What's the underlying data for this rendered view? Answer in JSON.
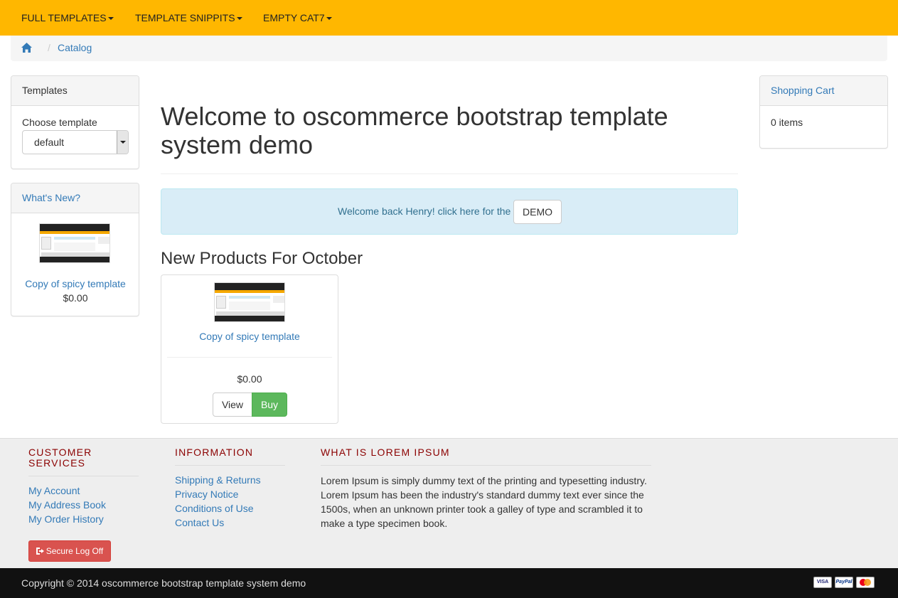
{
  "navbar": {
    "items": [
      {
        "label": "FULL TEMPLATES"
      },
      {
        "label": "TEMPLATE SNIPPITS"
      },
      {
        "label": "EMPTY CAT7"
      }
    ]
  },
  "breadcrumb": {
    "current": "Catalog"
  },
  "left": {
    "templates_panel": {
      "title": "Templates",
      "choose_label": "Choose template",
      "selected": "default"
    },
    "whats_new": {
      "title": "What's New?",
      "product_name": "Copy of spicy template",
      "price": "$0.00"
    }
  },
  "right": {
    "cart": {
      "title": "Shopping Cart",
      "items_text": "0 items"
    }
  },
  "main": {
    "title_line1": "Welcome to oscommerce bootstrap template",
    "title_line2": "system demo",
    "alert_text": "Welcome back Henry! click here for the",
    "demo_button": "DEMO",
    "section_title": "New Products For October",
    "product": {
      "name": "Copy of spicy template",
      "price": "$0.00",
      "view_label": "View",
      "buy_label": "Buy"
    }
  },
  "footer": {
    "col1": {
      "heading_line1": "CUSTOMER",
      "heading_line2": "SERVICES",
      "links": [
        "My Account",
        "My Address Book",
        "My Order History"
      ],
      "logoff_label": "Secure Log Off"
    },
    "col2": {
      "heading": "INFORMATION",
      "links": [
        "Shipping & Returns",
        "Privacy Notice",
        "Conditions of Use",
        "Contact Us"
      ]
    },
    "col3": {
      "heading": "WHAT IS LOREM IPSUM",
      "text": "Lorem Ipsum is simply dummy text of the printing and typesetting industry. Lorem Ipsum has been the industry's standard dummy text ever since the 1500s, when an unknown printer took a galley of type and scrambled it to make a type specimen book."
    },
    "copyright": "Copyright © 2014 oscommerce bootstrap template system demo",
    "payment_icons": [
      "visa-icon",
      "paypal-icon",
      "mastercard-icon"
    ]
  },
  "colors": {
    "navbar": "#ffb700",
    "link": "#337ab7",
    "footer_heading": "#8b0000",
    "buy": "#5cb85c",
    "logoff": "#d9534f"
  }
}
